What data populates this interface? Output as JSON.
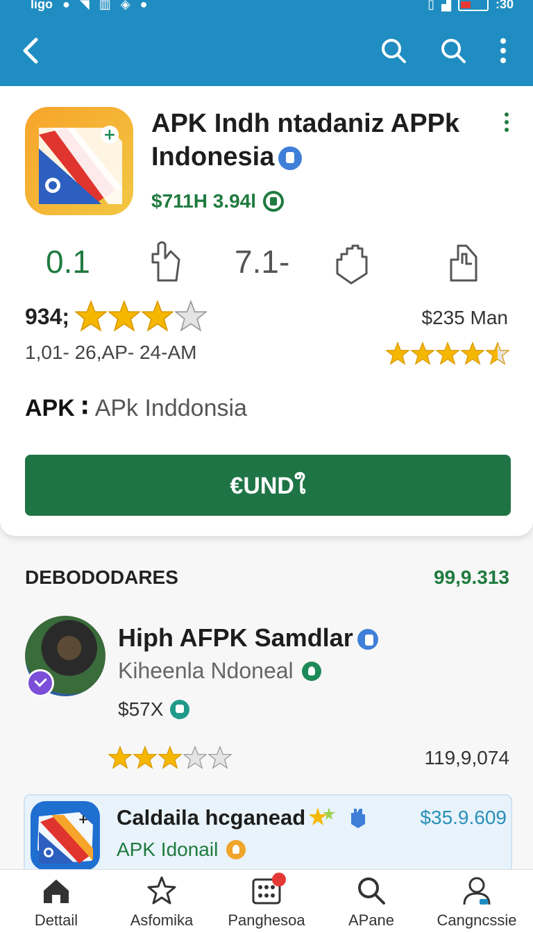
{
  "status_bar": {
    "left_text": "ligo",
    "right_text": ":30",
    "battery_level": 0.3
  },
  "app_bar": {
    "back_icon": "back-chevron-icon",
    "search_icons": [
      "search-icon",
      "search-icon"
    ],
    "menu_icon": "more-vertical-icon"
  },
  "app": {
    "title": "APK Indh ntadaniz APPk Indonesia",
    "price": "$711H 3.94l",
    "stats": [
      "0.1",
      "7.1-"
    ],
    "rating_text": "934;",
    "rating_stars": 3,
    "rating_max": 4,
    "date_text": "1,01- 26,AP- 24-AM",
    "right_price": "$235 Man",
    "right_stars": 4.5,
    "right_stars_max": 5,
    "label": "APK",
    "label_value": "APk Inddonsia",
    "install_label": "€UNDใ"
  },
  "section": {
    "title": "DEBODODARES",
    "count": "99,9.313"
  },
  "developer": {
    "name": "Hiph AFPK Samdlar",
    "subtitle": "Kiheenla Ndoneal",
    "price": "$57X",
    "stars": 3,
    "stars_max": 5,
    "count": "119,9,074"
  },
  "suggestion": {
    "title": "Caldaila hcganead",
    "subtitle": "APK Idonail",
    "price": "$35.9.609"
  },
  "bottom_nav": [
    {
      "label": "Dettail",
      "icon": "home-icon"
    },
    {
      "label": "Asfomika",
      "icon": "star-icon"
    },
    {
      "label": "Panghesoa",
      "icon": "grid-icon"
    },
    {
      "label": "APane",
      "icon": "search-icon"
    },
    {
      "label": "Cangncssie",
      "icon": "person-icon"
    }
  ],
  "colors": {
    "app_bar": "#1f8dc1",
    "primary_green": "#1f7446",
    "accent_green": "#1f7a3e",
    "star_gold": "#f5b700"
  }
}
